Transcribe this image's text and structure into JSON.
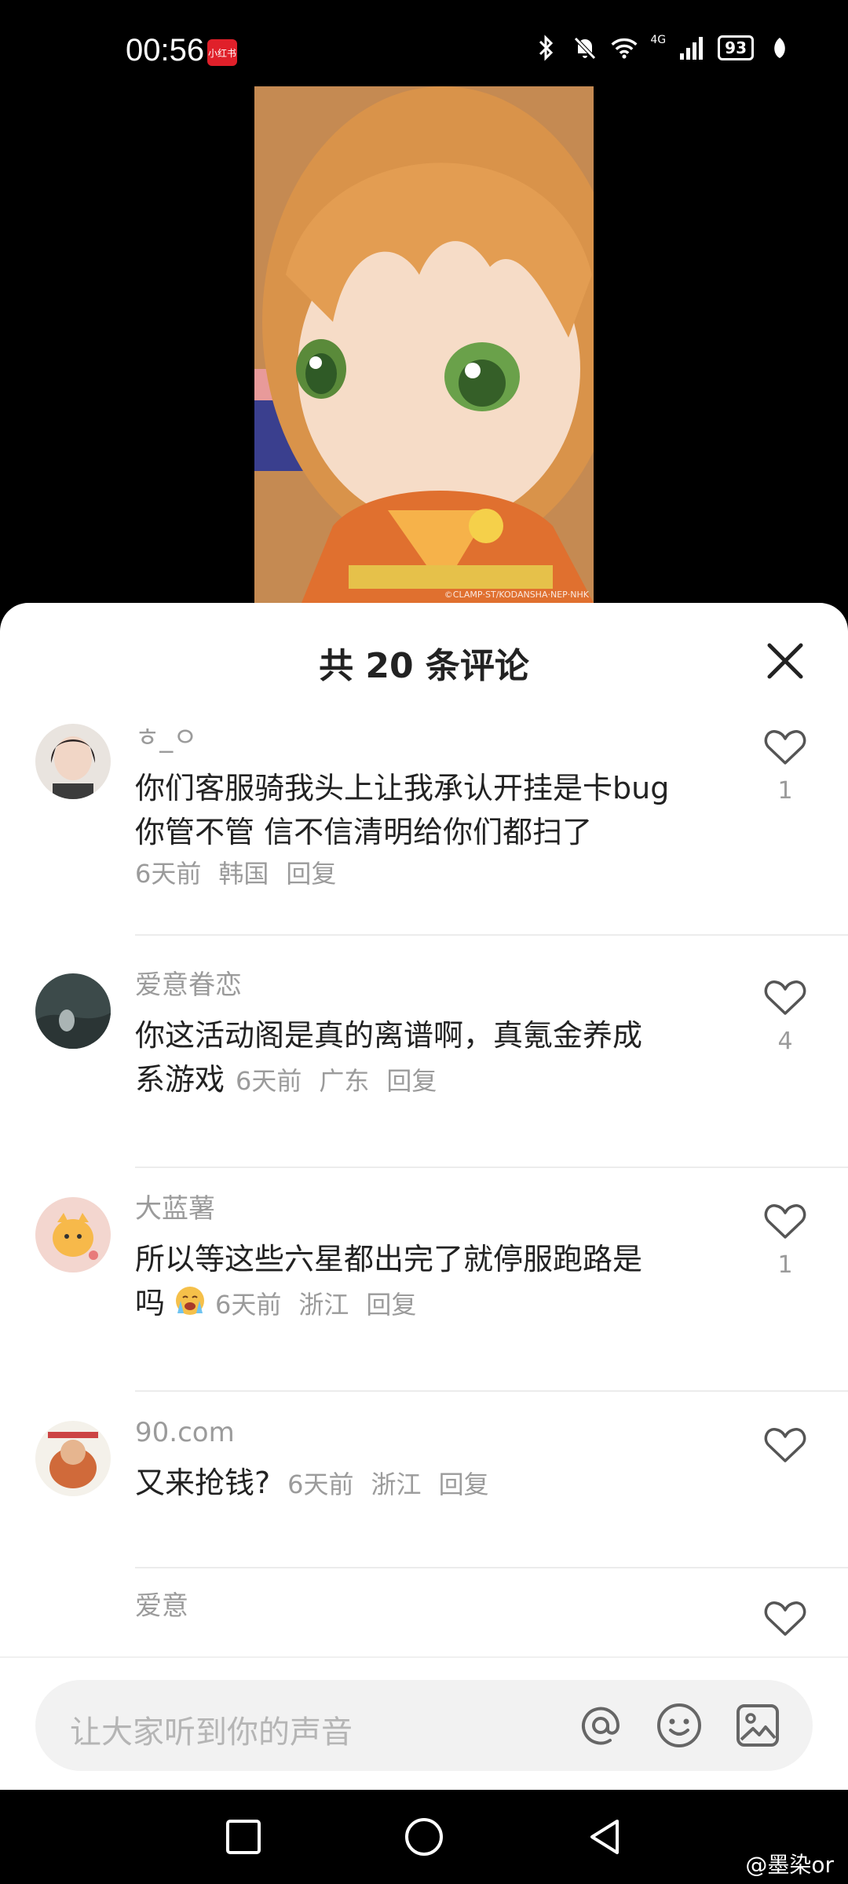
{
  "status_bar": {
    "time": "00:56",
    "badge": "小红书",
    "network": "4G",
    "battery": "93"
  },
  "video": {
    "watermark": "©CLAMP·ST/KODANSHA·NEP·NHK"
  },
  "sheet": {
    "title": "共 20 条评论"
  },
  "comments": [
    {
      "user": "ㅎ_ㅇ",
      "lines": [
        "你们客服骑我头上让我承认开挂是卡bug",
        "你管不管  信不信清明给你们都扫了"
      ],
      "time": "6天前",
      "location": "韩国",
      "reply": "回复",
      "likes": "1"
    },
    {
      "user": "爱意眷恋",
      "lines": [
        "你这活动阁是真的离谱啊，真氪金养成",
        "系游戏"
      ],
      "time": "6天前",
      "location": "广东",
      "reply": "回复",
      "likes": "4"
    },
    {
      "user": "大蓝薯",
      "lines": [
        "所以等这些六星都出完了就停服跑路是",
        "吗"
      ],
      "time": "6天前",
      "location": "浙江",
      "reply": "回复",
      "likes": "1"
    },
    {
      "user": "90.com",
      "lines": [
        "又来抢钱?"
      ],
      "time": "6天前",
      "location": "浙江",
      "reply": "回复",
      "likes": ""
    },
    {
      "user": "爱意",
      "lines": [],
      "time": "",
      "location": "",
      "reply": "",
      "likes": ""
    }
  ],
  "input": {
    "placeholder": "让大家听到你的声音"
  },
  "credit": "@墨染or",
  "colors": {
    "accent_badge": "#e0202a",
    "text_primary": "#222222",
    "text_secondary": "#9b9b9b",
    "input_bg": "#f2f2f2"
  }
}
